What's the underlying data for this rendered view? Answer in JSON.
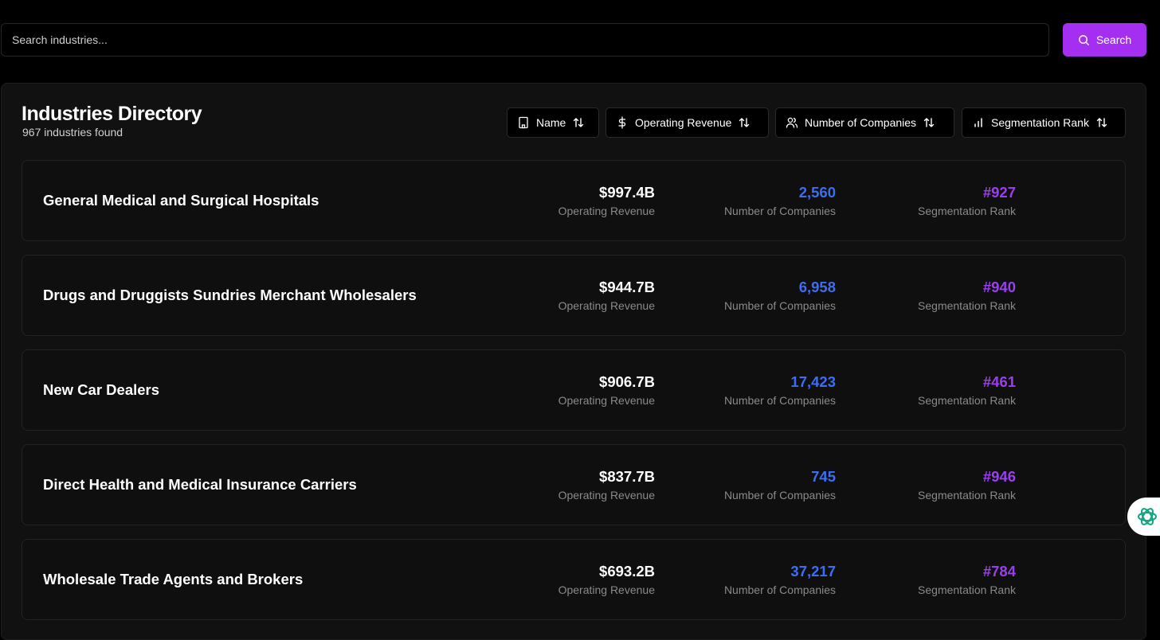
{
  "search": {
    "placeholder": "Search industries...",
    "button_label": "Search"
  },
  "directory": {
    "title": "Industries Directory",
    "subtitle": "967 industries found",
    "sort_buttons": [
      {
        "label": "Name",
        "icon": "building-icon"
      },
      {
        "label": "Operating Revenue",
        "icon": "dollar-icon"
      },
      {
        "label": "Number of Companies",
        "icon": "users-icon"
      },
      {
        "label": "Segmentation Rank",
        "icon": "bar-chart-icon"
      }
    ],
    "rows": [
      {
        "name": "General Medical and Surgical Hospitals",
        "revenue": "$997.4B",
        "revenue_label": "Operating Revenue",
        "companies": "2,560",
        "companies_label": "Number of Companies",
        "rank": "#927",
        "rank_label": "Segmentation Rank"
      },
      {
        "name": "Drugs and Druggists Sundries Merchant Wholesalers",
        "revenue": "$944.7B",
        "revenue_label": "Operating Revenue",
        "companies": "6,958",
        "companies_label": "Number of Companies",
        "rank": "#940",
        "rank_label": "Segmentation Rank"
      },
      {
        "name": "New Car Dealers",
        "revenue": "$906.7B",
        "revenue_label": "Operating Revenue",
        "companies": "17,423",
        "companies_label": "Number of Companies",
        "rank": "#461",
        "rank_label": "Segmentation Rank"
      },
      {
        "name": "Direct Health and Medical Insurance Carriers",
        "revenue": "$837.7B",
        "revenue_label": "Operating Revenue",
        "companies": "745",
        "companies_label": "Number of Companies",
        "rank": "#946",
        "rank_label": "Segmentation Rank"
      },
      {
        "name": "Wholesale Trade Agents and Brokers",
        "revenue": "$693.2B",
        "revenue_label": "Operating Revenue",
        "companies": "37,217",
        "companies_label": "Number of Companies",
        "rank": "#784",
        "rank_label": "Segmentation Rank"
      }
    ]
  },
  "colors": {
    "accent": "#a52ff0",
    "companies_value": "#3b6ef5",
    "rank_value": "#9b3df0",
    "assistant_icon": "#10a37f"
  },
  "assistant": {
    "icon": "openai-logo-icon"
  }
}
